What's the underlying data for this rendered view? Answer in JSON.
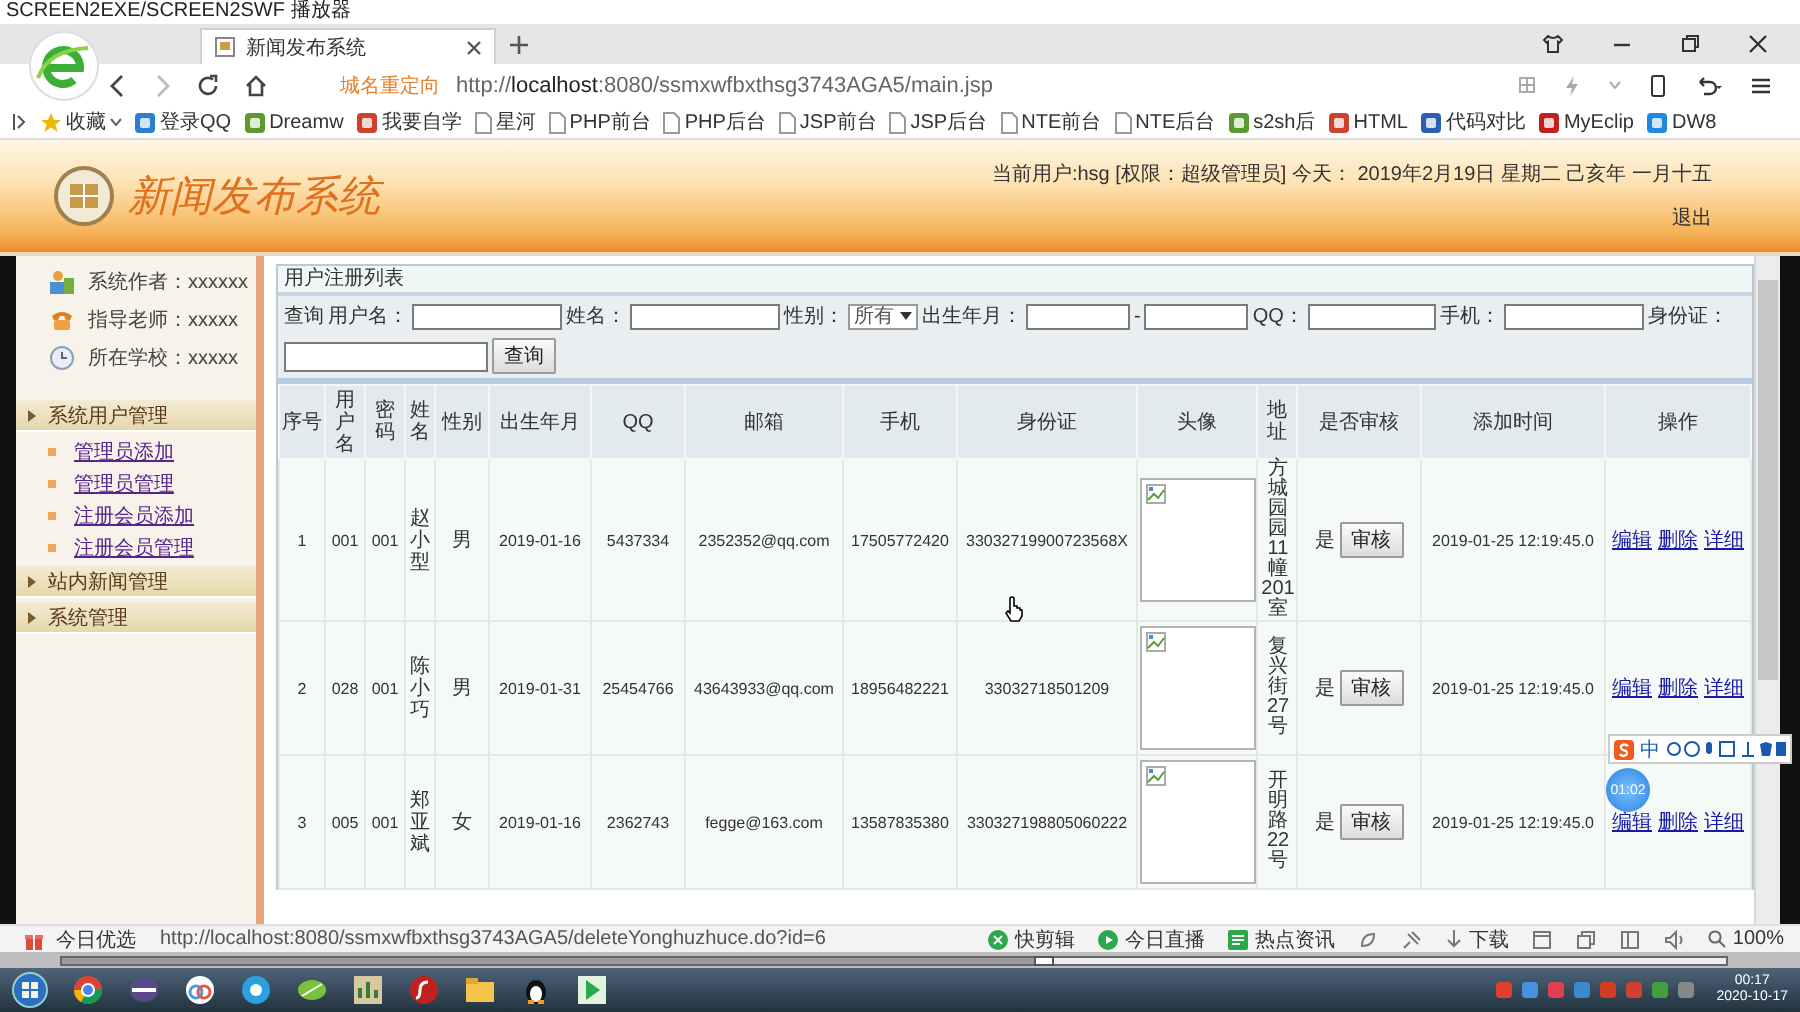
{
  "player_window": {
    "title": "SCREEN2EXE/SCREEN2SWF 播放器"
  },
  "browser": {
    "tabs": [
      {
        "title": "新闻发布系统",
        "selected": true
      }
    ],
    "redirect_label": "城名重定向",
    "url": "http://**localhost**:8080/ssmxwfbxthsg3743AGA5/main.jsp",
    "bookmarks": [
      {
        "label": "收藏",
        "kind": "favorites"
      },
      {
        "label": "登录QQ",
        "kind": "site"
      },
      {
        "label": "Dreamw",
        "kind": "site"
      },
      {
        "label": "我要自学",
        "kind": "site"
      },
      {
        "label": "星河",
        "kind": "page"
      },
      {
        "label": "PHP前台",
        "kind": "page"
      },
      {
        "label": "PHP后台",
        "kind": "page"
      },
      {
        "label": "JSP前台",
        "kind": "page"
      },
      {
        "label": "JSP后台",
        "kind": "page"
      },
      {
        "label": "NTE前台",
        "kind": "page"
      },
      {
        "label": "NTE后台",
        "kind": "page"
      },
      {
        "label": "s2sh后",
        "kind": "site"
      },
      {
        "label": "HTML",
        "kind": "site"
      },
      {
        "label": "代码对比",
        "kind": "site"
      },
      {
        "label": "MyEclip",
        "kind": "site"
      },
      {
        "label": "DW8",
        "kind": "site"
      }
    ]
  },
  "header": {
    "title": "新闻发布系统",
    "user_info": "当前用户:hsg [权限：超级管理员] 今天： 2019年2月19日 星期二 己亥年 一月十五",
    "logout": "退出"
  },
  "sidebar": {
    "info": [
      {
        "label": "系统作者：xxxxxx",
        "kind": "author"
      },
      {
        "label": "指导老师：xxxxx",
        "kind": "teacher"
      },
      {
        "label": "所在学校：xxxxx",
        "kind": "school"
      }
    ],
    "menu": [
      {
        "label": "系统用户管理",
        "children": [
          {
            "label": "管理员添加"
          },
          {
            "label": "管理员管理"
          },
          {
            "label": "注册会员添加"
          },
          {
            "label": "注册会员管理"
          }
        ]
      },
      {
        "label": "站内新闻管理"
      },
      {
        "label": "系统管理"
      }
    ]
  },
  "user_list": {
    "title": "用户注册列表",
    "search": {
      "prefix": "查询",
      "fields": [
        {
          "label": "用户名：",
          "kind": "text"
        },
        {
          "label": "姓名：",
          "kind": "text"
        },
        {
          "label": "性别：",
          "kind": "select",
          "value": "所有"
        },
        {
          "label": "出生年月：",
          "kind": "range",
          "separator": "-"
        },
        {
          "label": "QQ：",
          "kind": "text"
        },
        {
          "label": "手机：",
          "kind": "text"
        },
        {
          "label": "身份证：",
          "kind": "wide"
        }
      ],
      "button": "查询"
    },
    "table": {
      "columns": [
        "序号",
        "用户名",
        "密码",
        "姓名",
        "性别",
        "出生年月",
        "QQ",
        "邮箱",
        "手机",
        "身份证",
        "头像",
        "地址",
        "是否审核",
        "添加时间",
        "操作"
      ],
      "rows": [
        {
          "cells": [
            "1",
            "001",
            "001",
            "赵小型",
            "男",
            "2019-01-16",
            "5437334",
            "2352352@qq.com",
            "17505772420",
            "33032719900723568X"
          ],
          "address": "方城园园11幢201室",
          "approved": "是",
          "approve_button": "审核",
          "added": "2019-01-25 12:19:45.0",
          "actions": [
            "编辑",
            "删除",
            "详细"
          ]
        },
        {
          "cells": [
            "2",
            "028",
            "001",
            "陈小巧",
            "男",
            "2019-01-31",
            "25454766",
            "43643933@qq.com",
            "18956482221",
            "33032718501209"
          ],
          "address": "复兴街27号",
          "approved": "是",
          "approve_button": "审核",
          "added": "2019-01-25 12:19:45.0",
          "actions": [
            "编辑",
            "删除",
            "详细"
          ]
        },
        {
          "cells": [
            "3",
            "005",
            "001",
            "郑亚斌",
            "女",
            "2019-01-16",
            "2362743",
            "fegge@163.com",
            "13587835380",
            "330327198805060222"
          ],
          "address": "开明路22号",
          "approved": "是",
          "approve_button": "审核",
          "added": "2019-01-25 12:19:45.0",
          "actions": [
            "编辑",
            "删除",
            "详细"
          ]
        }
      ]
    }
  },
  "status_bar": {
    "promo": "今日优选",
    "link_url": "http://localhost:8080/ssmxwfbxthsg3743AGA5/deleteYonghuzhuce.do?id=6",
    "items": [
      {
        "label": "快剪辑",
        "kind": "clip"
      },
      {
        "label": "今日直播",
        "kind": "live"
      },
      {
        "label": "热点资讯",
        "kind": "news"
      }
    ],
    "download": "下载",
    "zoom": "100%"
  },
  "player": {
    "level": 0.59
  },
  "taskbar": {
    "time": "00:17",
    "date": "2020-10-17"
  },
  "ime_bar": {
    "mode": "中"
  },
  "recorder_badge": "01:02"
}
